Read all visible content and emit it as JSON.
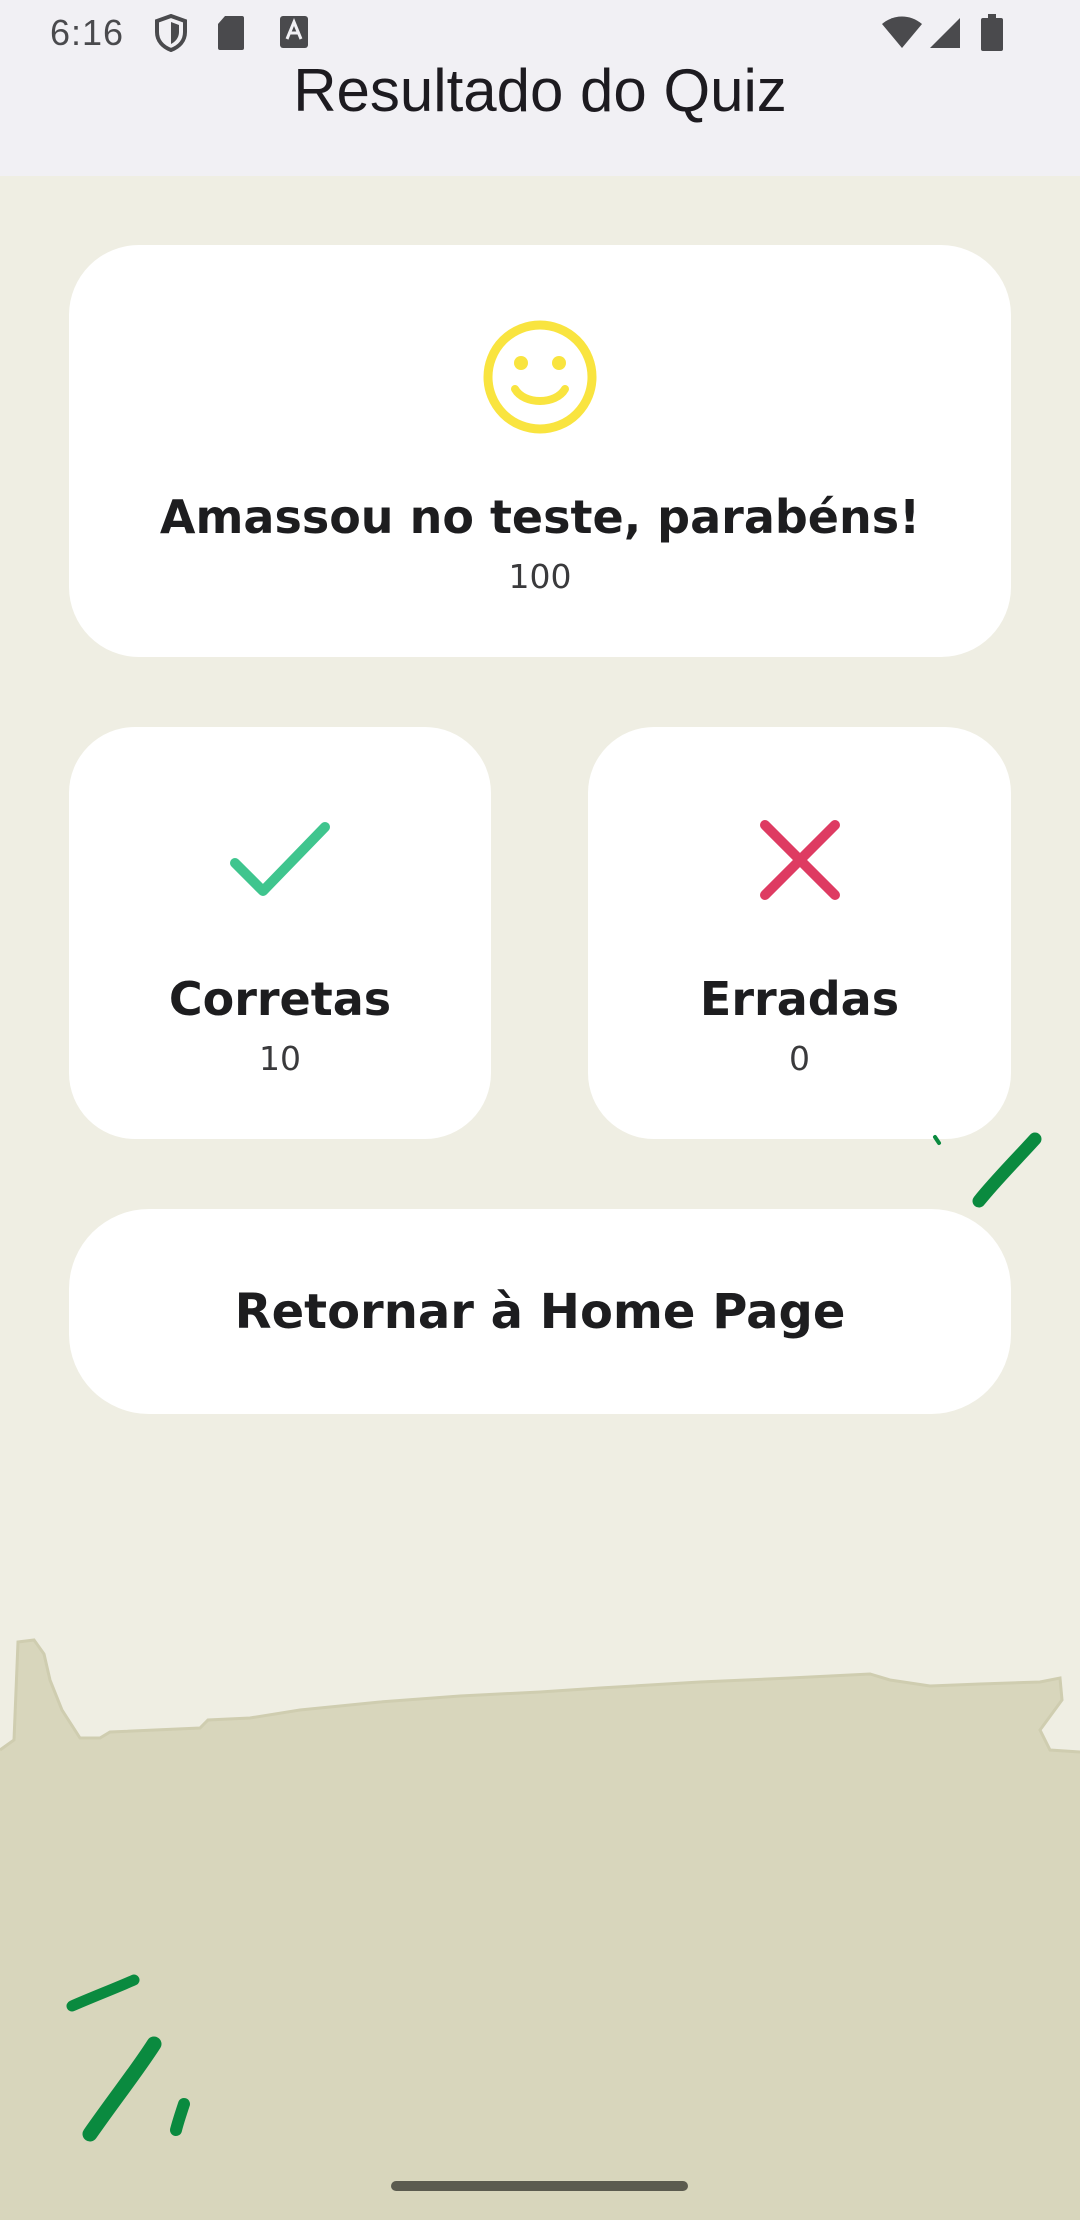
{
  "status_bar": {
    "time": "6:16",
    "icons": [
      "shield-icon",
      "sd-card-icon",
      "keyboard-a-icon",
      "wifi-icon",
      "signal-icon",
      "battery-icon"
    ]
  },
  "app_bar": {
    "title": "Resultado do Quiz"
  },
  "score_card": {
    "icon": "smiley-icon",
    "message": "Amassou no teste, parabéns!",
    "score": "100"
  },
  "correct_card": {
    "icon": "check-icon",
    "label": "Corretas",
    "value": "10"
  },
  "wrong_card": {
    "icon": "close-icon",
    "label": "Erradas",
    "value": "0"
  },
  "home_button": {
    "label": "Retornar à Home Page"
  },
  "colors": {
    "background": "#efeee3",
    "ground": "#d8d6bc",
    "smiley": "#f9e43f",
    "check": "#3fc58e",
    "cross": "#de3b62",
    "leaf": "#0a8a3f"
  }
}
